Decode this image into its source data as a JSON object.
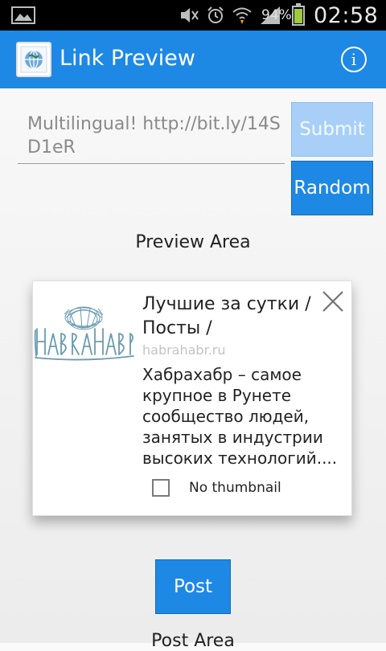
{
  "status_bar": {
    "battery_percent": "94%",
    "battery_level": 0.94,
    "time": "02:58"
  },
  "action_bar": {
    "title": "Link Preview",
    "info_icon": "info-icon",
    "color": "#1e88e5"
  },
  "form": {
    "url_value": "Multilingual! http://bit.ly/14SD1eR",
    "submit_label": "Submit",
    "random_label": "Random"
  },
  "preview": {
    "section_label": "Preview Area",
    "card": {
      "title": "Лучшие за сутки / Посты /",
      "domain": "habrahabr.ru",
      "description": "Хабрахабр – самое крупное в Рунете сообщество людей, занятых в индустрии высоких технологий....",
      "no_thumbnail_label": "No thumbnail",
      "no_thumbnail_checked": false
    }
  },
  "post": {
    "button_label": "Post",
    "section_label": "Post Area"
  }
}
